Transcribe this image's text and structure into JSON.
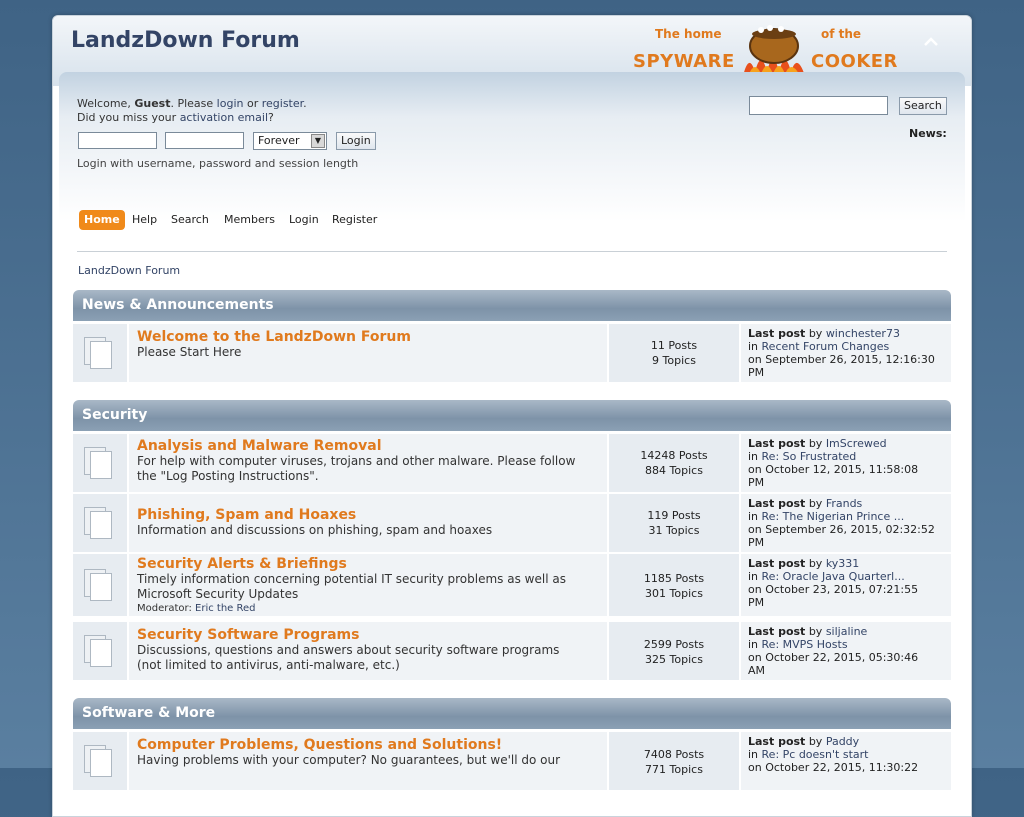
{
  "header": {
    "title": "LandzDown Forum",
    "logo": {
      "line1_left": "The home",
      "line1_right": "of the",
      "word_left": "SPYWARE",
      "word_right": "COOKER"
    },
    "collapse_icon": "collapse-caret-icon"
  },
  "user": {
    "welcome_prefix": "Welcome,",
    "guest": "Guest",
    "please": ". Please",
    "login_link": "login",
    "or": "or",
    "register_link": "register",
    "period": ".",
    "activation_prefix": "Did you miss your",
    "activation_link": "activation email",
    "activation_suffix": "?",
    "session_select": "Forever",
    "login_button": "Login",
    "login_hint": "Login with username, password and session length"
  },
  "search": {
    "button": "Search"
  },
  "news": {
    "label": "News:"
  },
  "menu": {
    "items": [
      "Home",
      "Help",
      "Search",
      "Members",
      "Login",
      "Register"
    ]
  },
  "breadcrumb": "LandzDown Forum",
  "categories": [
    {
      "name": "News & Announcements",
      "boards": [
        {
          "title": "Welcome to the LandzDown Forum",
          "desc1": "Please Start Here",
          "desc2": "",
          "moderator_label": "",
          "moderator": "",
          "posts": "11 Posts",
          "topics": "9 Topics",
          "last_label": "Last post",
          "last_by": "by",
          "last_user": "winchester73",
          "last_in": "in",
          "last_topic": "Recent Forum Changes",
          "last_date1": "on September 26, 2015, 12:16:30",
          "last_date2": "PM"
        }
      ]
    },
    {
      "name": "Security",
      "boards": [
        {
          "title": "Analysis and Malware Removal",
          "desc1": "For help with computer viruses, trojans and other malware. Please follow",
          "desc2": "the \"Log Posting Instructions\".",
          "moderator_label": "",
          "moderator": "",
          "posts": "14248 Posts",
          "topics": "884 Topics",
          "last_label": "Last post",
          "last_by": "by",
          "last_user": "ImScrewed",
          "last_in": "in",
          "last_topic": "Re: So Frustrated",
          "last_date1": "on October 12, 2015, 11:58:08",
          "last_date2": "PM"
        },
        {
          "title": "Phishing, Spam and Hoaxes",
          "desc1": "Information and discussions on phishing, spam and hoaxes",
          "desc2": "",
          "moderator_label": "",
          "moderator": "",
          "posts": "119 Posts",
          "topics": "31 Topics",
          "last_label": "Last post",
          "last_by": "by",
          "last_user": "Frands",
          "last_in": "in",
          "last_topic": "Re: The Nigerian Prince ...",
          "last_date1": "on September 26, 2015, 02:32:52",
          "last_date2": "PM"
        },
        {
          "title": "Security Alerts & Briefings",
          "desc1": "Timely information concerning potential IT security problems as well as",
          "desc2": "Microsoft Security Updates",
          "moderator_label": "Moderator:",
          "moderator": "Eric the Red",
          "posts": "1185 Posts",
          "topics": "301 Topics",
          "last_label": "Last post",
          "last_by": "by",
          "last_user": "ky331",
          "last_in": "in",
          "last_topic": "Re: Oracle Java Quarterl...",
          "last_date1": "on October 23, 2015, 07:21:55",
          "last_date2": "PM"
        },
        {
          "title": "Security Software Programs",
          "desc1": "Discussions, questions and answers about security software programs",
          "desc2": "(not limited to antivirus, anti-malware, etc.)",
          "moderator_label": "",
          "moderator": "",
          "posts": "2599 Posts",
          "topics": "325 Topics",
          "last_label": "Last post",
          "last_by": "by",
          "last_user": "siljaline",
          "last_in": "in",
          "last_topic": "Re: MVPS Hosts",
          "last_date1": "on October 22, 2015, 05:30:46",
          "last_date2": "AM"
        }
      ]
    },
    {
      "name": "Software & More",
      "boards": [
        {
          "title": "Computer Problems, Questions and Solutions!",
          "desc1": "Having problems with your computer? No guarantees, but we'll do our",
          "desc2": "",
          "moderator_label": "",
          "moderator": "",
          "posts": "7408 Posts",
          "topics": "771 Topics",
          "last_label": "Last post",
          "last_by": "by",
          "last_user": "Paddy",
          "last_in": "in",
          "last_topic": "Re: Pc doesn't start",
          "last_date1": "on October 22, 2015, 11:30:22",
          "last_date2": ""
        }
      ]
    }
  ]
}
